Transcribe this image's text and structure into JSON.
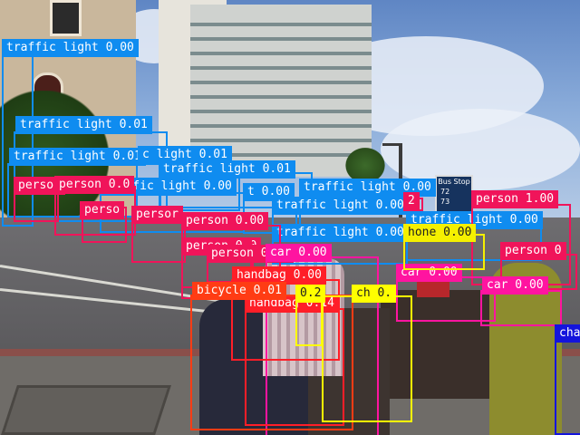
{
  "palette": {
    "traffic_light": "#0f8cf0",
    "person": "#f0145a",
    "car": "#ff14a0",
    "handbag": "#ff1e28",
    "bicycle": "#ff3c14",
    "chair": "#ffff00",
    "bench": "#e6e600",
    "phone": "#f5f000",
    "misc_blue": "#1414dc",
    "teal": "#00dcc8",
    "green": "#28f050",
    "stripe": "#ffffff"
  },
  "street_sign": {
    "line1": "Bus Stop",
    "line2": "72",
    "line3": "73"
  },
  "detections": [
    {
      "label": "traffic light 0.00",
      "kind": "traffic_light"
    },
    {
      "label": "traffic light 0.01",
      "kind": "traffic_light"
    },
    {
      "label": "traffic light 0.01",
      "kind": "traffic_light"
    },
    {
      "label": "c light 0.01",
      "kind": "traffic_light"
    },
    {
      "label": "traffic light 0.01",
      "kind": "traffic_light"
    },
    {
      "label": "traffic light 0.00",
      "kind": "traffic_light"
    },
    {
      "label": "t 0.00",
      "kind": "traffic_light"
    },
    {
      "label": "traffic light 0.00",
      "kind": "traffic_light"
    },
    {
      "label": "traffic light 0.00",
      "kind": "traffic_light"
    },
    {
      "label": "traffic light 0.00",
      "kind": "traffic_light"
    },
    {
      "label": "traffic light 0.00",
      "kind": "traffic_light"
    },
    {
      "label": "person 1.00",
      "kind": "person"
    },
    {
      "label": "person 0",
      "kind": "person"
    },
    {
      "label": "person",
      "kind": "person"
    },
    {
      "label": "person 0.0",
      "kind": "person"
    },
    {
      "label": "perso",
      "kind": "person"
    },
    {
      "label": "persor",
      "kind": "person"
    },
    {
      "label": "person 0.00",
      "kind": "person"
    },
    {
      "label": "person 0.0",
      "kind": "person"
    },
    {
      "label": "person 0.00",
      "kind": "person"
    },
    {
      "label": "car 0.00",
      "kind": "car"
    },
    {
      "label": "car 0.00",
      "kind": "car"
    },
    {
      "label": "car 0.00",
      "kind": "car"
    },
    {
      "label": "handbag 0.00",
      "kind": "handbag"
    },
    {
      "label": "handbag 0.14",
      "kind": "handbag"
    },
    {
      "label": "bicycle 0.01",
      "kind": "bicycle"
    },
    {
      "label": "hone 0.00",
      "kind": "phone"
    },
    {
      "label": "ch 0.",
      "kind": "chair"
    },
    {
      "label": "0.2",
      "kind": "chair"
    },
    {
      "label": "2",
      "kind": "person"
    },
    {
      "label": "cha",
      "kind": "misc_blue"
    }
  ]
}
